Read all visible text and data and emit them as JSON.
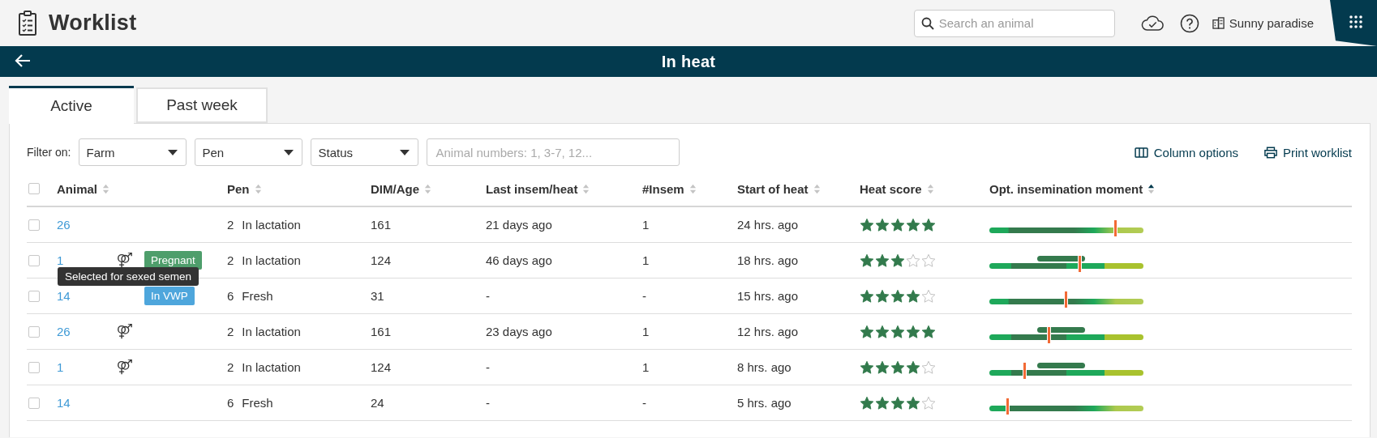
{
  "app": {
    "title": "Worklist"
  },
  "search": {
    "placeholder": "Search an animal"
  },
  "farm": {
    "name": "Sunny paradise"
  },
  "page_title": "In heat",
  "tabs": [
    {
      "label": "Active",
      "selected": true
    },
    {
      "label": "Past week",
      "selected": false
    }
  ],
  "filters": {
    "label": "Filter on:",
    "dropdowns": [
      {
        "value": "Farm"
      },
      {
        "value": "Pen"
      },
      {
        "value": "Status"
      }
    ],
    "animal_numbers": {
      "placeholder": "Animal numbers: 1, 3-7, 12..."
    }
  },
  "actions": [
    {
      "kind": "columns",
      "label": "Column options"
    },
    {
      "kind": "print",
      "label": "Print worklist"
    }
  ],
  "table": {
    "select_all": {
      "checked": false
    },
    "columns": [
      {
        "label": "Animal",
        "sorted_ascending": false
      },
      {
        "label": "Pen",
        "sorted_ascending": false
      },
      {
        "label": "DIM/Age",
        "sorted_ascending": false
      },
      {
        "label": "Last insem/heat",
        "sorted_ascending": false
      },
      {
        "label": "#Insem",
        "sorted_ascending": false
      },
      {
        "label": "Start of heat",
        "sorted_ascending": false
      },
      {
        "label": "Heat score",
        "sorted_ascending": false
      },
      {
        "label": "Opt. insemination moment",
        "sorted_ascending": true
      }
    ],
    "rows": [
      {
        "checked": false,
        "animal": "26",
        "sexed_semen": false,
        "pen_number": "2",
        "pen_name": "In lactation",
        "dim_age": "161",
        "last_insem_heat": "21 days ago",
        "insem_count": "1",
        "start_of_heat": "24 hrs. ago",
        "stars": 5,
        "timeline": {
          "kind": "gradient",
          "level": 0.81
        }
      },
      {
        "checked": false,
        "animal": "1",
        "sexed_semen": true,
        "tooltip": "Selected for sexed semen",
        "badge": {
          "label": "Pregnant",
          "color": "#4e9e6b"
        },
        "pen_number": "2",
        "pen_name": "In lactation",
        "dim_age": "124",
        "last_insem_heat": "46 days ago",
        "insem_count": "1",
        "start_of_heat": "18 hrs. ago",
        "stars": 3,
        "timeline": {
          "kind": "window",
          "level": 0.58
        }
      },
      {
        "checked": false,
        "animal": "14",
        "sexed_semen": false,
        "badge": {
          "label": "In VWP",
          "color": "#4ea6dc"
        },
        "pen_number": "6",
        "pen_name": "Fresh",
        "dim_age": "31",
        "last_insem_heat": "-",
        "insem_count": "-",
        "start_of_heat": "15 hrs. ago",
        "stars": 4,
        "timeline": {
          "kind": "gradient",
          "level": 0.49
        }
      },
      {
        "checked": false,
        "animal": "26",
        "sexed_semen": true,
        "pen_number": "2",
        "pen_name": "In lactation",
        "dim_age": "161",
        "last_insem_heat": "23 days ago",
        "insem_count": "1",
        "start_of_heat": "12 hrs. ago",
        "stars": 5,
        "timeline": {
          "kind": "window",
          "level": 0.38
        }
      },
      {
        "checked": false,
        "animal": "1",
        "sexed_semen": true,
        "pen_number": "2",
        "pen_name": "In lactation",
        "dim_age": "124",
        "last_insem_heat": "-",
        "insem_count": "1",
        "start_of_heat": "8 hrs. ago",
        "stars": 4,
        "timeline": {
          "kind": "window",
          "level": 0.22
        }
      },
      {
        "checked": false,
        "animal": "14",
        "sexed_semen": false,
        "pen_number": "6",
        "pen_name": "Fresh",
        "dim_age": "24",
        "last_insem_heat": "-",
        "insem_count": "-",
        "start_of_heat": "5 hrs. ago",
        "stars": 4,
        "timeline": {
          "kind": "gradient",
          "level": 0.11
        }
      }
    ]
  }
}
